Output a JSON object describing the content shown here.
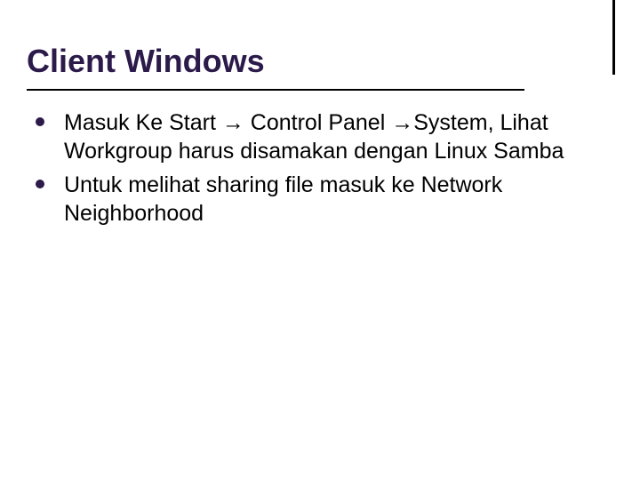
{
  "title": "Client Windows",
  "bullets": [
    "Masuk Ke Start → Control Panel →System, Lihat Workgroup harus disamakan dengan Linux Samba",
    "Untuk melihat sharing file masuk ke Network Neighborhood"
  ]
}
